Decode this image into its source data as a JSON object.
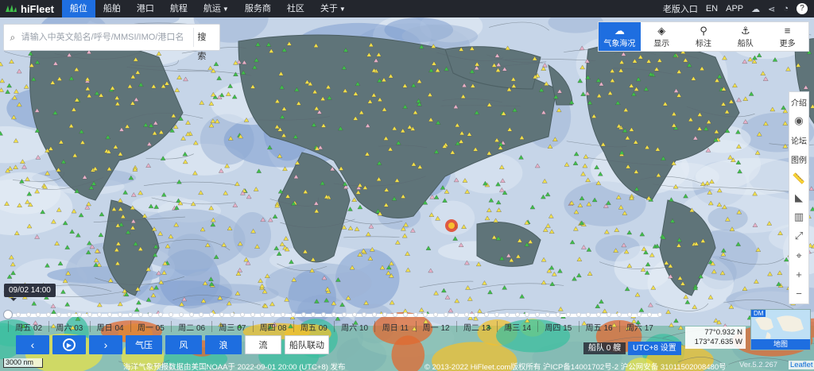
{
  "brand": {
    "name": "hiFleet",
    "accent": "#1e6ee0"
  },
  "nav": {
    "items": [
      {
        "label": "船位",
        "active": true
      },
      {
        "label": "船舶"
      },
      {
        "label": "港口"
      },
      {
        "label": "航程"
      },
      {
        "label": "航运",
        "caret": true
      },
      {
        "label": "服务商"
      },
      {
        "label": "社区"
      },
      {
        "label": "关于",
        "caret": true
      }
    ],
    "right": {
      "old_version": "老版入口",
      "lang": "EN",
      "app": "APP",
      "icons": [
        "chat-icon",
        "share-icon",
        "bell-icon",
        "user-avatar-icon"
      ]
    }
  },
  "search": {
    "placeholder": "请输入中英文船名/呼号/MMSI/IMO/港口名",
    "button": "搜索"
  },
  "toolbar": [
    {
      "label": "气象海况",
      "icon": "weather-icon",
      "active": true
    },
    {
      "label": "显示",
      "icon": "layers-icon"
    },
    {
      "label": "标注",
      "icon": "pin-icon"
    },
    {
      "label": "船队",
      "icon": "fleet-icon"
    },
    {
      "label": "更多",
      "icon": "menu-icon"
    }
  ],
  "side_tools": [
    {
      "label": "介绍"
    },
    {
      "label": "",
      "icon": "eye-icon"
    },
    {
      "label": "论坛"
    },
    {
      "label": "图例"
    },
    {
      "label": "",
      "icon": "ruler-icon"
    },
    {
      "label": "",
      "icon": "angle-icon"
    },
    {
      "label": "",
      "icon": "chart-icon"
    },
    {
      "label": "",
      "icon": "fullscreen-icon"
    },
    {
      "label": "",
      "icon": "locate-icon"
    },
    {
      "label": "+",
      "icon": "zoom-in-icon"
    },
    {
      "label": "−",
      "icon": "zoom-out-icon"
    }
  ],
  "timeline": {
    "current_time": "09/02 14:00",
    "days": [
      "周五 02",
      "周六 03",
      "周日 04",
      "周一 05",
      "周二 06",
      "周三 07",
      "周四 08",
      "周五 09",
      "周六 10",
      "周日 11",
      "周一 12",
      "周二 13",
      "周三 14",
      "周四 15",
      "周五 16",
      "周六 17"
    ]
  },
  "controls": {
    "pressure": "气压",
    "wind": "风",
    "wave": "浪",
    "current": "流",
    "fleet_link": "船队联动"
  },
  "status": {
    "fleet_count": "船队 0 艘",
    "utc": "UTC+8 设置",
    "lat": "77°0.932 N",
    "lon": "173°47.635 W",
    "minimap_badge": "DM",
    "minimap_label": "地图",
    "scale": "3000 nm"
  },
  "footer": {
    "data_note": "海洋气象预报数据由美国NOAA于 2022-09-01 20:00 (UTC+8) 发布",
    "copyright": "© 2013-2022 HiFleet.com版权所有 沪ICP备14001702号-2 沪公网安备 31011502008480号",
    "version": "Ver.5.2.267",
    "leaflet": "Leaflet"
  }
}
